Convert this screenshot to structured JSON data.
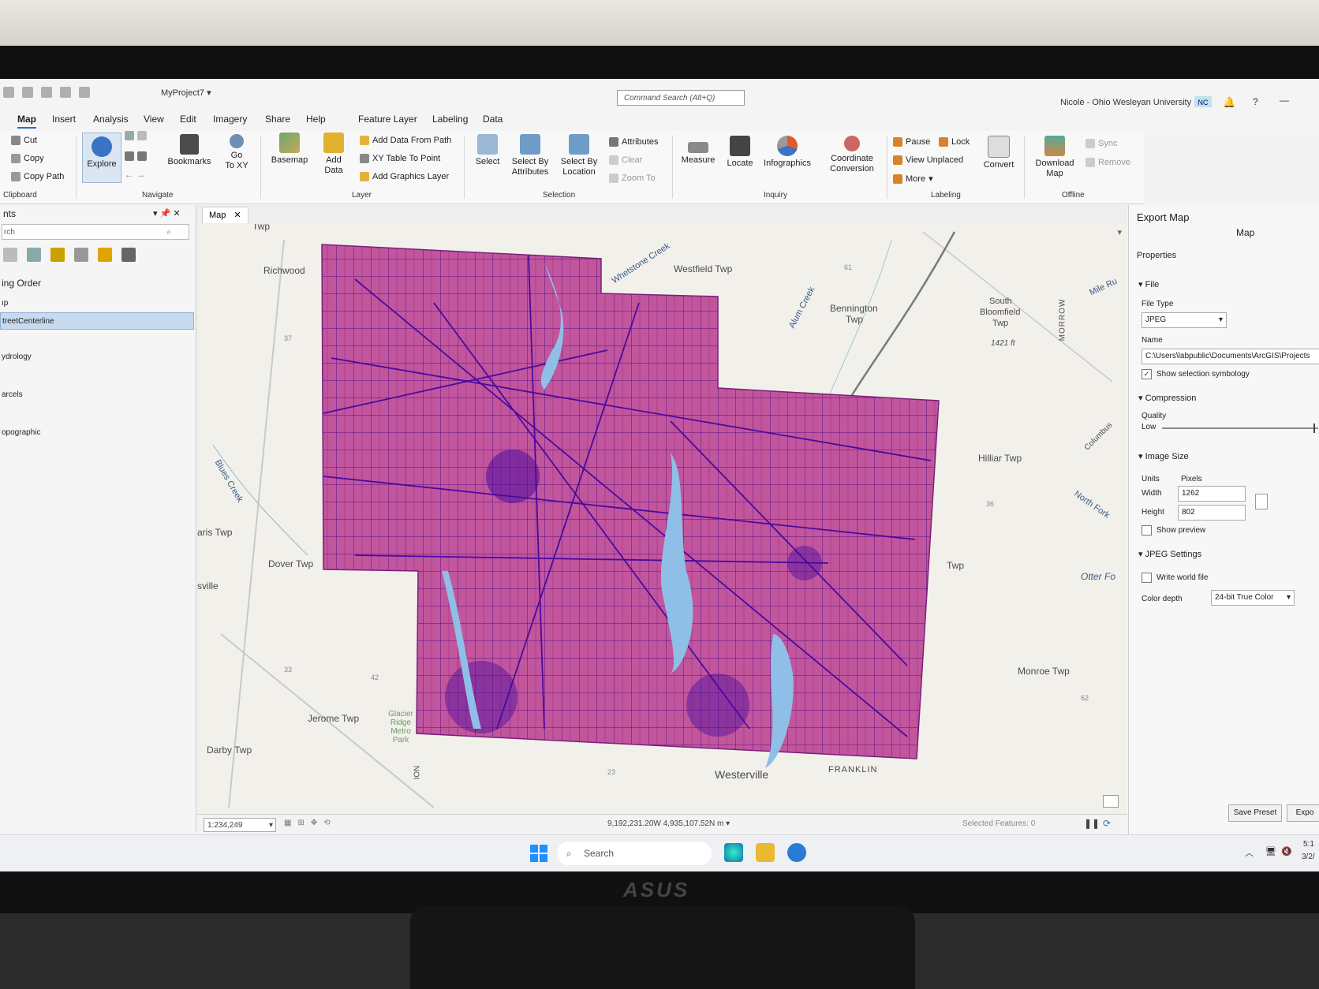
{
  "title_bar": {
    "project": "MyProject7",
    "command_search": "Command Search (Alt+Q)",
    "user": "Nicole - Ohio Wesleyan University",
    "user_initials": "NC",
    "help": "?",
    "minimize": "—"
  },
  "tabs": [
    "Map",
    "Insert",
    "Analysis",
    "View",
    "Edit",
    "Imagery",
    "Share",
    "Help"
  ],
  "context_tabs": [
    "Feature Layer",
    "Labeling",
    "Data"
  ],
  "ribbon": {
    "clipboard": {
      "cut": "Cut",
      "copy": "Copy",
      "copy_path": "Copy Path",
      "group": "Clipboard"
    },
    "navigate": {
      "explore": "Explore",
      "bookmarks": "Bookmarks",
      "go_to_xy_1": "Go",
      "go_to_xy_2": "To XY",
      "group": "Navigate"
    },
    "layer": {
      "basemap": "Basemap",
      "add_data_1": "Add",
      "add_data_2": "Data",
      "add_data_from_path": "Add Data From Path",
      "xy_table": "XY Table To Point",
      "add_graphics": "Add Graphics Layer",
      "group": "Layer"
    },
    "selection": {
      "select": "Select",
      "select_by_attr_1": "Select By",
      "select_by_attr_2": "Attributes",
      "select_by_loc_1": "Select By",
      "select_by_loc_2": "Location",
      "attributes": "Attributes",
      "clear": "Clear",
      "zoom_to": "Zoom To",
      "group": "Selection"
    },
    "inquiry": {
      "measure": "Measure",
      "locate": "Locate",
      "infographics": "Infographics",
      "coord_1": "Coordinate",
      "coord_2": "Conversion",
      "group": "Inquiry"
    },
    "labeling": {
      "pause": "Pause",
      "lock": "Lock",
      "view_unplaced": "View Unplaced",
      "more": "More",
      "convert": "Convert",
      "group": "Labeling"
    },
    "offline": {
      "download_1": "Download",
      "download_2": "Map",
      "sync": "Sync",
      "remove": "Remove",
      "group": "Offline"
    }
  },
  "contents_pane": {
    "title": "nts",
    "search": "rch",
    "drawing_order": "ing Order",
    "items": [
      {
        "label": "ıp",
        "selected": false
      },
      {
        "label": "treetCenterline",
        "selected": true
      },
      {
        "label": "ydrology",
        "selected": false
      },
      {
        "label": "arcels",
        "selected": false
      },
      {
        "label": "opographic",
        "selected": false
      }
    ]
  },
  "map": {
    "tab": "Map",
    "labels": {
      "twp_top": "Twp",
      "richwood": "Richwood",
      "whetstone": "Whetstone Creek",
      "westfield": "Westfield Twp",
      "alum": "Alum Creek",
      "bennington_1": "Bennington",
      "bennington_2": "Twp",
      "south_bloomfield_1": "South",
      "south_bloomfield_2": "Bloomfield",
      "south_bloomfield_3": "Twp",
      "elev": "1421 ft",
      "mile_run": "Mile Ru",
      "morrow": "MORROW",
      "blues_creek": "Blues Creek",
      "hilliar": "Hilliar Twp",
      "columbus": "Columbus",
      "north_fork": "North Fork",
      "aris_twp": "aris Twp",
      "dover": "Dover Twp",
      "sville": "sville",
      "twp_right": "Twp",
      "otter": "Otter Fo",
      "monroe": "Monroe Twp",
      "jerome": "Jerome Twp",
      "glacier": "Glacier Ridge Metro Park",
      "darby": "Darby Twp",
      "westerville": "Westerville",
      "franklin": "FRANKLIN",
      "ion": "ION",
      "rt37": "37",
      "rt61": "61",
      "rt33": "33",
      "rt42": "42",
      "rt36": "36",
      "rt23": "23",
      "rt62": "62"
    },
    "scale": "1:234,249",
    "coordinates": "9,192,231.20W 4,935,107.52N m",
    "selected_features": "Selected Features: 0"
  },
  "export_pane": {
    "title": "Export Map",
    "map_label": "Map",
    "properties": "Properties",
    "file_section": "File",
    "file_type_label": "File Type",
    "file_type": "JPEG",
    "name_label": "Name",
    "name_value": "C:\\Users\\labpublic\\Documents\\ArcGIS\\Projects",
    "show_selection": "Show selection symbology",
    "compression": "Compression",
    "quality_label": "Quality",
    "quality_value": "Low",
    "quality_level": 0.97,
    "image_size": "Image Size",
    "units_label": "Units",
    "units_value": "Pixels",
    "width_label": "Width",
    "width_value": "1262",
    "height_label": "Height",
    "height_value": "802",
    "show_preview": "Show preview",
    "jpeg_settings": "JPEG Settings",
    "write_world": "Write world file",
    "color_depth_label": "Color depth",
    "color_depth_value": "24-bit True Color",
    "save_preset": "Save Preset",
    "export": "Expo"
  },
  "taskbar": {
    "search": "Search",
    "time": "5:1",
    "date": "3/2/"
  },
  "monitor_brand": "ASUS",
  "colors": {
    "parcels": "#c2569d",
    "streets": "#4a0a9e",
    "water": "#8fbfe6",
    "accent": "#2f6fbf"
  }
}
